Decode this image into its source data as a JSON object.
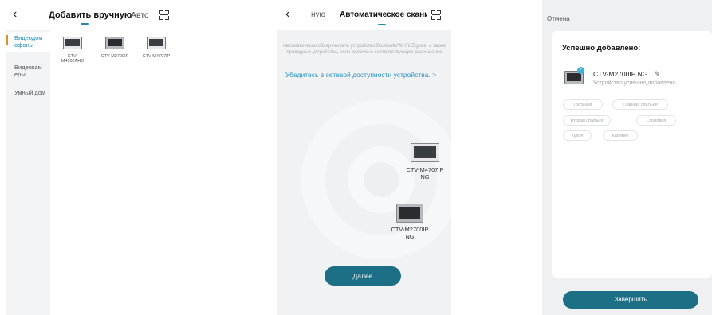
{
  "panel1": {
    "tabs": {
      "manual": "Добавить вручную",
      "auto": "Автоматическое сканирование"
    },
    "sidebar": [
      {
        "label": "Видеодом офоны",
        "active": true
      },
      {
        "label": "Видеокам еры",
        "active": false
      },
      {
        "label": "Умный дом",
        "active": false
      }
    ],
    "devices": [
      {
        "name": "CTV-M4102AHD"
      },
      {
        "name": "CTV-M2700IP"
      },
      {
        "name": "CTV-M4707IP"
      }
    ]
  },
  "panel2": {
    "tabs": {
      "manual": "ную",
      "auto": "Автоматическое сканирование"
    },
    "description": "Автоматически обнаруживать устройство Bluetooth/Wi-Fi/ Zigbee, а также проводные устройства, если включено соответствующее разрешение",
    "link": "Убедитесь в сетевой доступности устройства. >",
    "devices": [
      {
        "name": "CTV-M4707IP NG"
      },
      {
        "name": "CTV-M2700IP NG"
      }
    ],
    "next_button": "Далее"
  },
  "panel3": {
    "cancel": "Отмена",
    "title": "Успешно добавлено:",
    "device_name": "CTV-M2700IP NG",
    "device_status": "Устройство успешно добавлено",
    "rooms": [
      "Гостиная",
      "Главная спальня",
      "Вторая спальня",
      "Столовая",
      "Кухня",
      "Кабинет"
    ],
    "finish_button": "Завершить"
  },
  "colors": {
    "accent": "#1e8bb0",
    "button": "#1d6f85",
    "link": "#2b94c4",
    "sidebar_marker": "#e38b2a"
  }
}
